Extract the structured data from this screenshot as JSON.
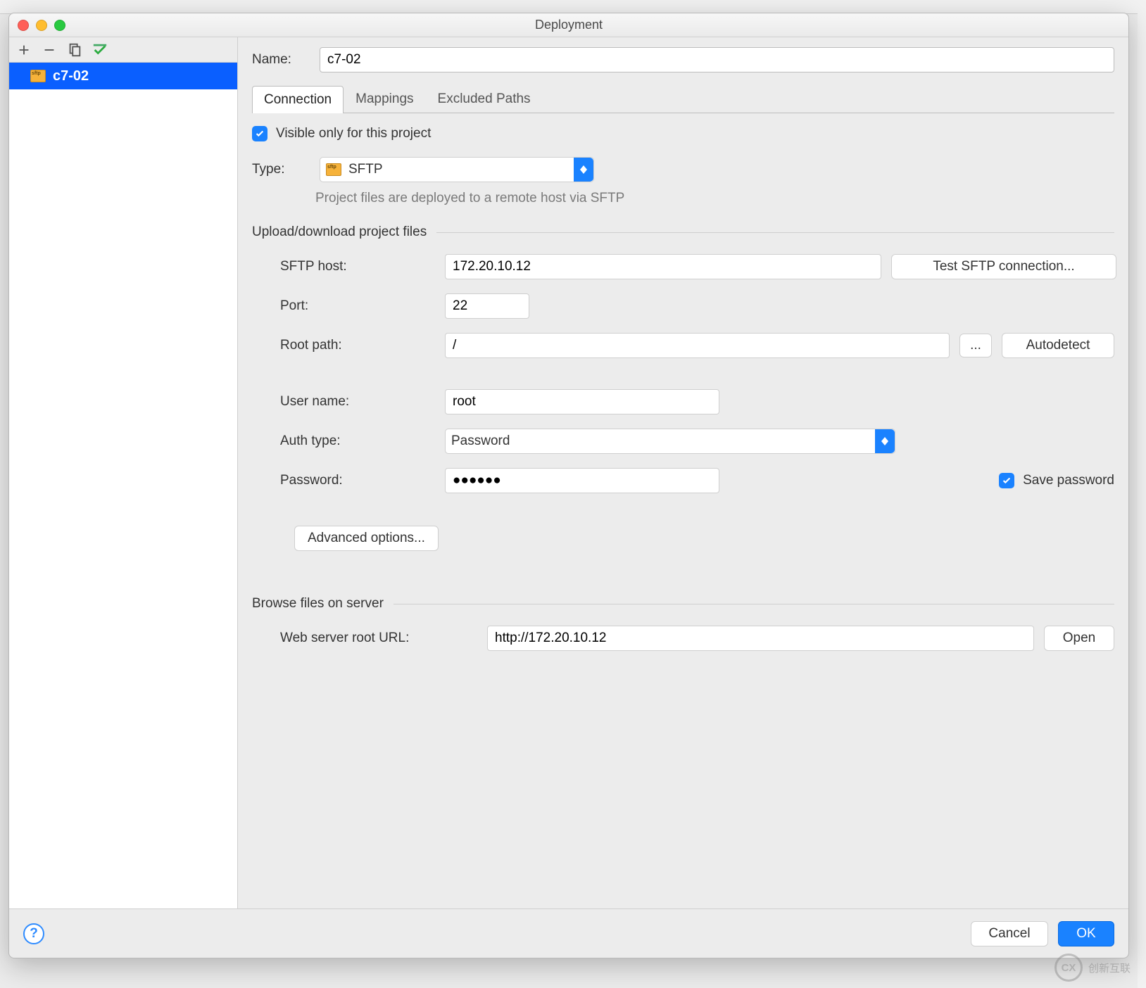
{
  "window": {
    "title": "Deployment"
  },
  "sidebar": {
    "items": [
      {
        "label": "c7-02",
        "icon": "sftp-icon"
      }
    ]
  },
  "main": {
    "name_label": "Name:",
    "name_value": "c7-02",
    "tabs": [
      {
        "label": "Connection"
      },
      {
        "label": "Mappings"
      },
      {
        "label": "Excluded Paths"
      }
    ],
    "visible_only_label": "Visible only for this project",
    "type_label": "Type:",
    "type_value": "SFTP",
    "type_hint": "Project files are deployed to a remote host via SFTP",
    "section_upload": "Upload/download project files",
    "sftp_host_label": "SFTP host:",
    "sftp_host_value": "172.20.10.12",
    "test_connection_label": "Test SFTP connection...",
    "port_label": "Port:",
    "port_value": "22",
    "root_path_label": "Root path:",
    "root_path_value": "/",
    "browse_label": "...",
    "autodetect_label": "Autodetect",
    "username_label": "User name:",
    "username_value": "root",
    "auth_type_label": "Auth type:",
    "auth_type_value": "Password",
    "password_label": "Password:",
    "password_value": "●●●●●●",
    "save_password_label": "Save password",
    "advanced_label": "Advanced options...",
    "section_browse": "Browse files on server",
    "web_root_label": "Web server root URL:",
    "web_root_value": "http://172.20.10.12",
    "open_label": "Open"
  },
  "footer": {
    "help": "?",
    "cancel": "Cancel",
    "ok": "OK"
  },
  "watermark": {
    "text": "创新互联",
    "short": "CX"
  }
}
